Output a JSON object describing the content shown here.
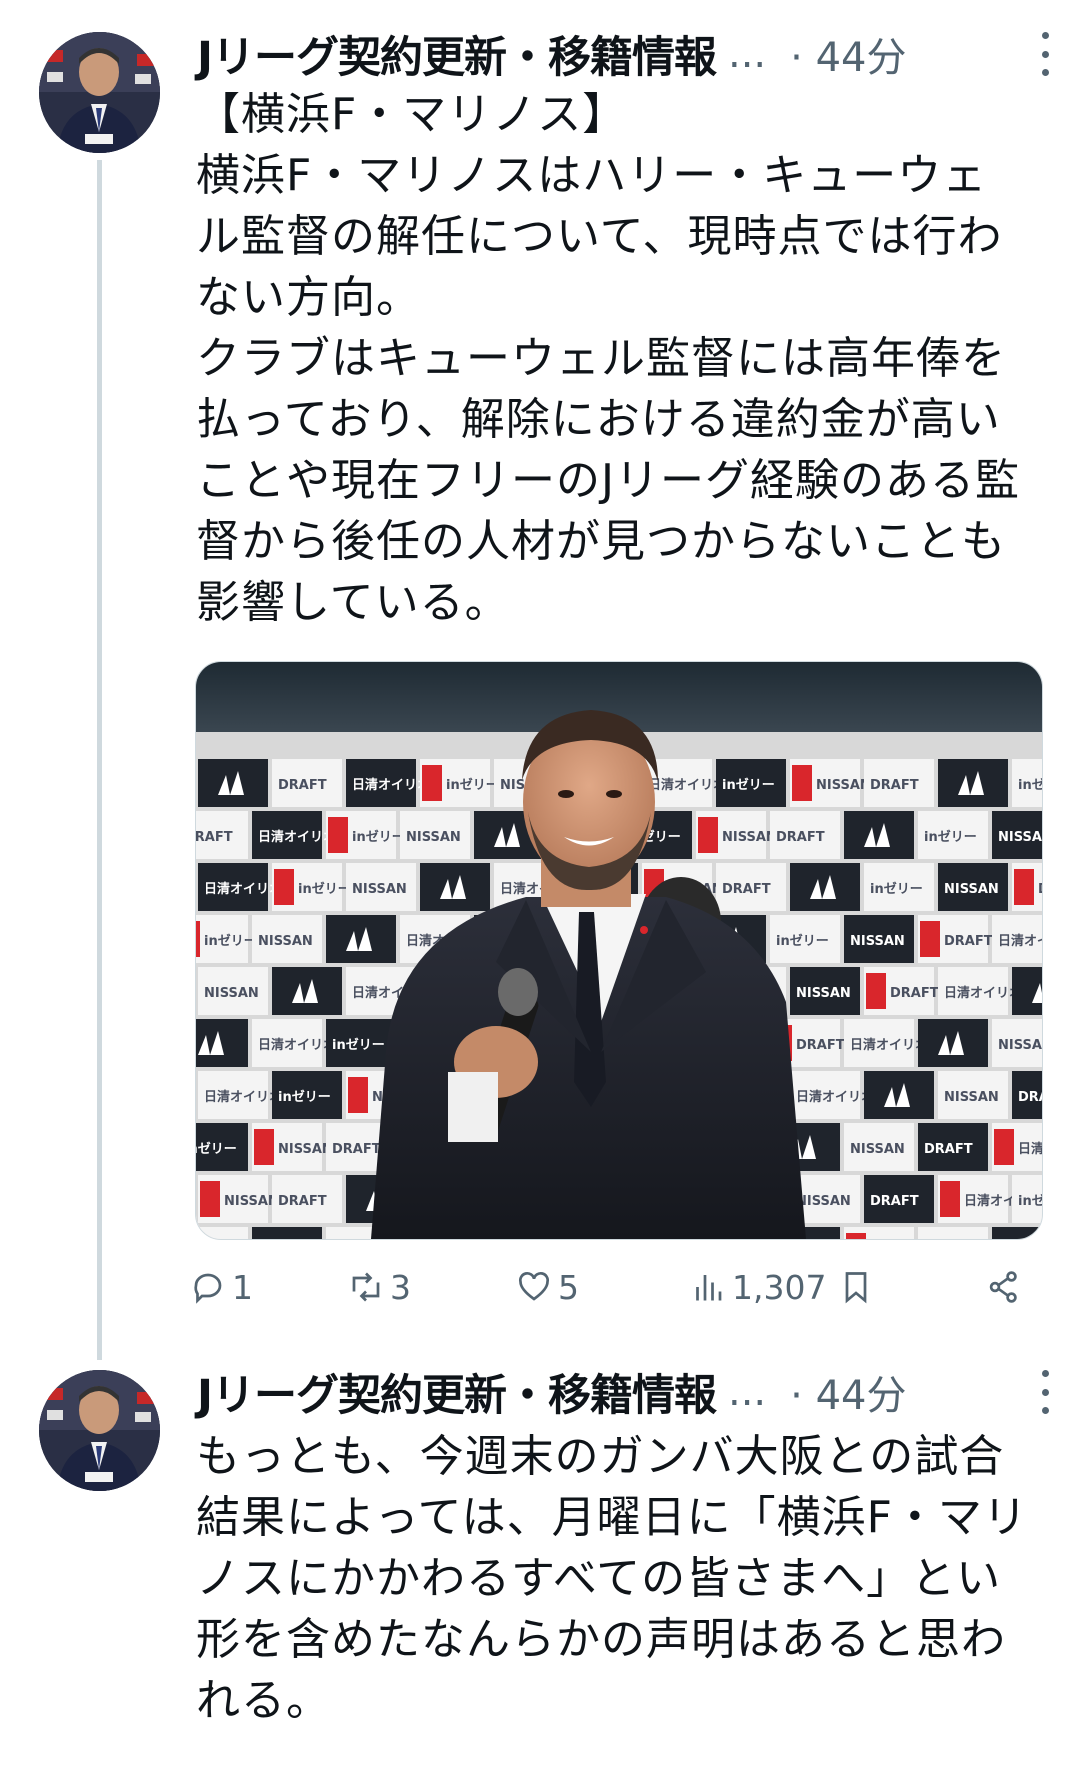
{
  "thread": [
    {
      "author": "Jリーグ契約更新・移籍情報",
      "ellipsis": "...",
      "timestamp": "· 44分",
      "body": "【横浜F・マリノス】\n横浜F・マリノスはハリー・キューウェ\nル監督の解任について、現時点では行わ\nない方向。\nクラブはキューウェル監督には高年俸を\n払っており、解除における違約金が高い\nことや現在フリーのJリーグ経験のある監\n督から後任の人材が見つからないことも\n影響している。",
      "media": {
        "backdrop_labels": [
          "NISSAN",
          "DRAFT",
          "日清オイリオ",
          "inゼリー"
        ]
      },
      "actions": {
        "reply": "1",
        "retweet": "3",
        "like": "5",
        "views": "1,307"
      }
    },
    {
      "author": "Jリーグ契約更新・移籍情報",
      "ellipsis": "...",
      "timestamp": "· 44分",
      "body": "もっとも、今週末のガンバ大阪との試合\n結果によっては、月曜日に「横浜F・マリ\nノスにかかわるすべての皆さまへ」とい\n形を含めたなんらかの声明はあると思わ\nれる。"
    }
  ],
  "colors": {
    "text_primary": "#0f1419",
    "text_secondary": "#536471",
    "thread_line": "#cfd9de",
    "backdrop_red": "#d9262c"
  },
  "icons": {
    "reply": "speech-bubble-icon",
    "retweet": "repost-arrows-icon",
    "like": "heart-icon",
    "views": "bar-chart-icon",
    "bookmark": "bookmark-icon",
    "share": "share-icon",
    "more": "vertical-dots-icon"
  }
}
